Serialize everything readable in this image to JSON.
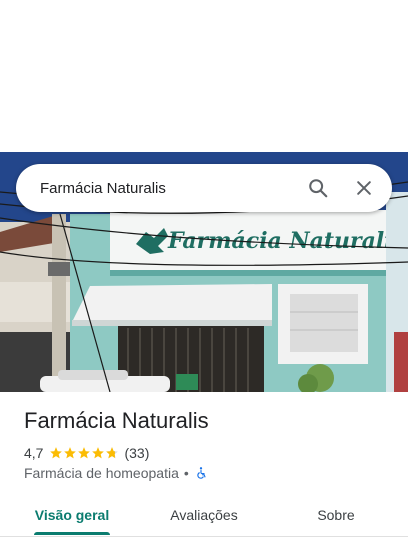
{
  "search": {
    "query": "Farmácia Naturalis"
  },
  "photo": {
    "sign_text": "Farmácia Naturalis"
  },
  "place": {
    "name": "Farmácia Naturalis",
    "rating": "4,7",
    "rating_value": 4.7,
    "review_count": "(33)",
    "category": "Farmácia de homeopatia",
    "separator": "•"
  },
  "tabs": [
    {
      "label": "Visão geral",
      "active": true
    },
    {
      "label": "Avaliações",
      "active": false
    },
    {
      "label": "Sobre",
      "active": false
    }
  ],
  "colors": {
    "accent": "#0b7c6f",
    "star": "#fbbc04",
    "accessibility": "#1a73e8"
  },
  "icons": {
    "search": "search-icon",
    "close": "close-icon",
    "accessibility": "wheelchair-icon"
  }
}
